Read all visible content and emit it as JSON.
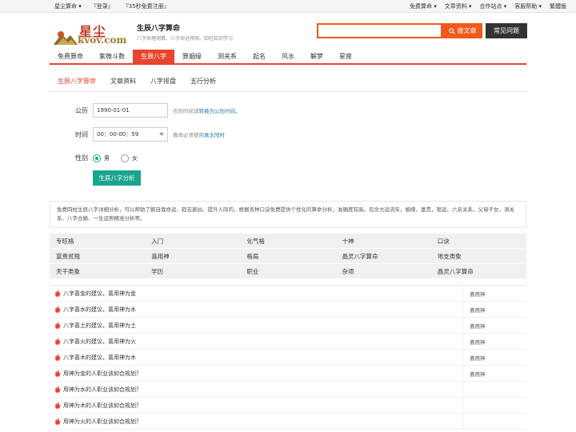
{
  "topbar": {
    "left": [
      "星尘算命 ▾",
      "『登录』",
      "『35秒免费注册』"
    ],
    "right": [
      "免费算命 ▾",
      "文章资料 ▾",
      "合作站点 ▾",
      "客服帮助 ▾",
      "繁體版"
    ]
  },
  "header": {
    "brand_cn": "星尘",
    "brand_en": "kvov.com",
    "title": "生辰八字算命",
    "subtitle": "八字命理测算、八字命运预测、四柱知识学习",
    "search_button": "搜文章",
    "faq_button": "常见问题"
  },
  "mainnav": [
    "免费算命",
    "紫微斗数",
    "生辰八字",
    "算姻缘",
    "测关系",
    "起名",
    "风水",
    "解梦",
    "星座"
  ],
  "subtabs": [
    "生辰八字算命",
    "文章资料",
    "八字排盘",
    "五行分析"
  ],
  "form": {
    "date_label": "公历",
    "date_value": "1990-01-01",
    "date_hint_prefix": "农历时间请",
    "date_hint_link": "转换为公历时间。",
    "time_label": "时间",
    "time_value": "00：00-00：59",
    "time_hint_prefix": "算命必须使用",
    "time_hint_link": "真太阳时",
    "gender_label": "性别",
    "male": "男",
    "female": "女",
    "submit": "生辰八字分析"
  },
  "description": "免费四柱生辰八字详细分析，可以帮助了解自我命运、趋吉避凶、提升人际的，根据各种口诀免费提供个性化的算命分析，准确度较高。包含大运流年，姻缘，富贵，限运、六亲关系，父母子女，测关系、八字合婚、一生运势精准分析等。",
  "grid": [
    [
      "专旺格",
      "入门",
      "化气格",
      "十神",
      "口诀"
    ],
    [
      "富贵贫贱",
      "喜用神",
      "格局",
      "晶灵八字算命",
      "地支类象"
    ],
    [
      "天干类象",
      "学历",
      "职业",
      "杂项",
      "晶灵八字算命"
    ]
  ],
  "articles": [
    {
      "title": "八字喜金的建议，喜用神为金",
      "tag": "喜用神"
    },
    {
      "title": "八字喜水的建议，喜用神为水",
      "tag": "喜用神"
    },
    {
      "title": "八字喜土的建议，喜用神为土",
      "tag": "喜用神"
    },
    {
      "title": "八字喜火的建议，喜用神为火",
      "tag": "喜用神"
    },
    {
      "title": "八字喜木的建议，喜用神为木",
      "tag": "喜用神"
    },
    {
      "title": "用神为金的人职业该如合规划？",
      "tag": "喜用神"
    },
    {
      "title": "用神为水的人职业该如合规划？",
      "tag": ""
    },
    {
      "title": "用神为木的人职业该如合规划？",
      "tag": ""
    },
    {
      "title": "用神为火的人职业该如合规划？",
      "tag": ""
    }
  ],
  "colors": {
    "accent": "#e8452c",
    "search": "#f05a1a",
    "submit": "#1aa58c"
  }
}
